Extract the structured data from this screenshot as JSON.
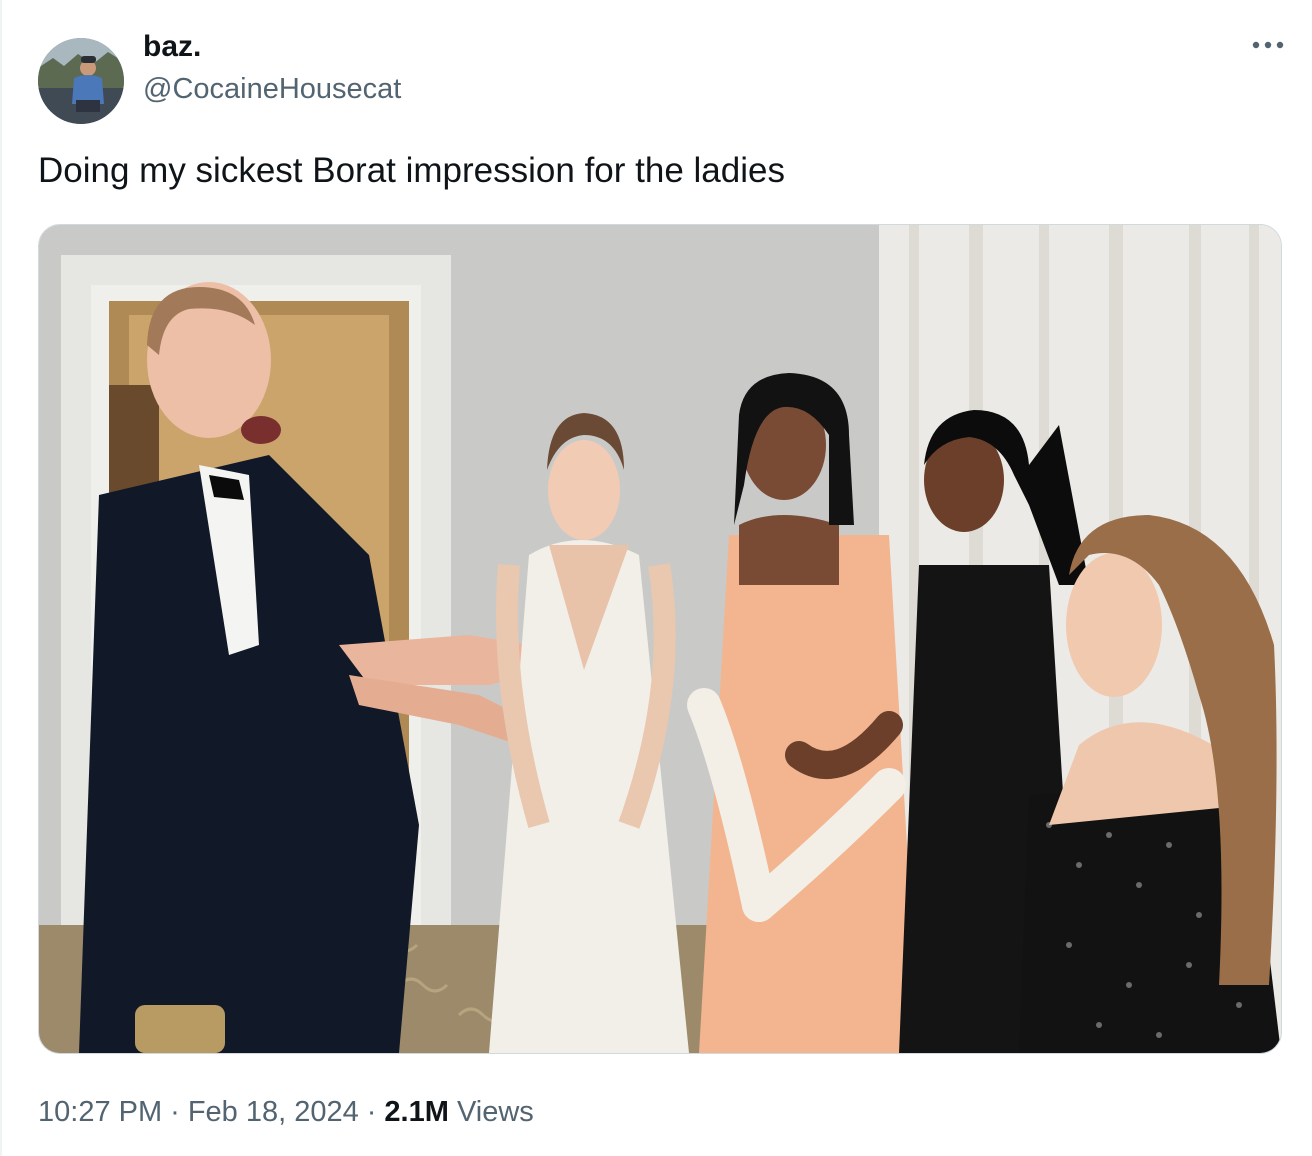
{
  "user": {
    "display_name": "baz.",
    "handle": "@CocaineHousecat",
    "avatar_icon": "profile-photo"
  },
  "more_icon": "more-horizontal-icon",
  "tweet": {
    "text": "Doing my sickest Borat impression for the ladies"
  },
  "meta": {
    "time": "10:27 PM",
    "separator": "·",
    "date": "Feb 18, 2024",
    "views_count": "2.1M",
    "views_label": "Views"
  },
  "colors": {
    "text_primary": "#0f1419",
    "text_secondary": "#536471",
    "border": "#cfd9de"
  }
}
